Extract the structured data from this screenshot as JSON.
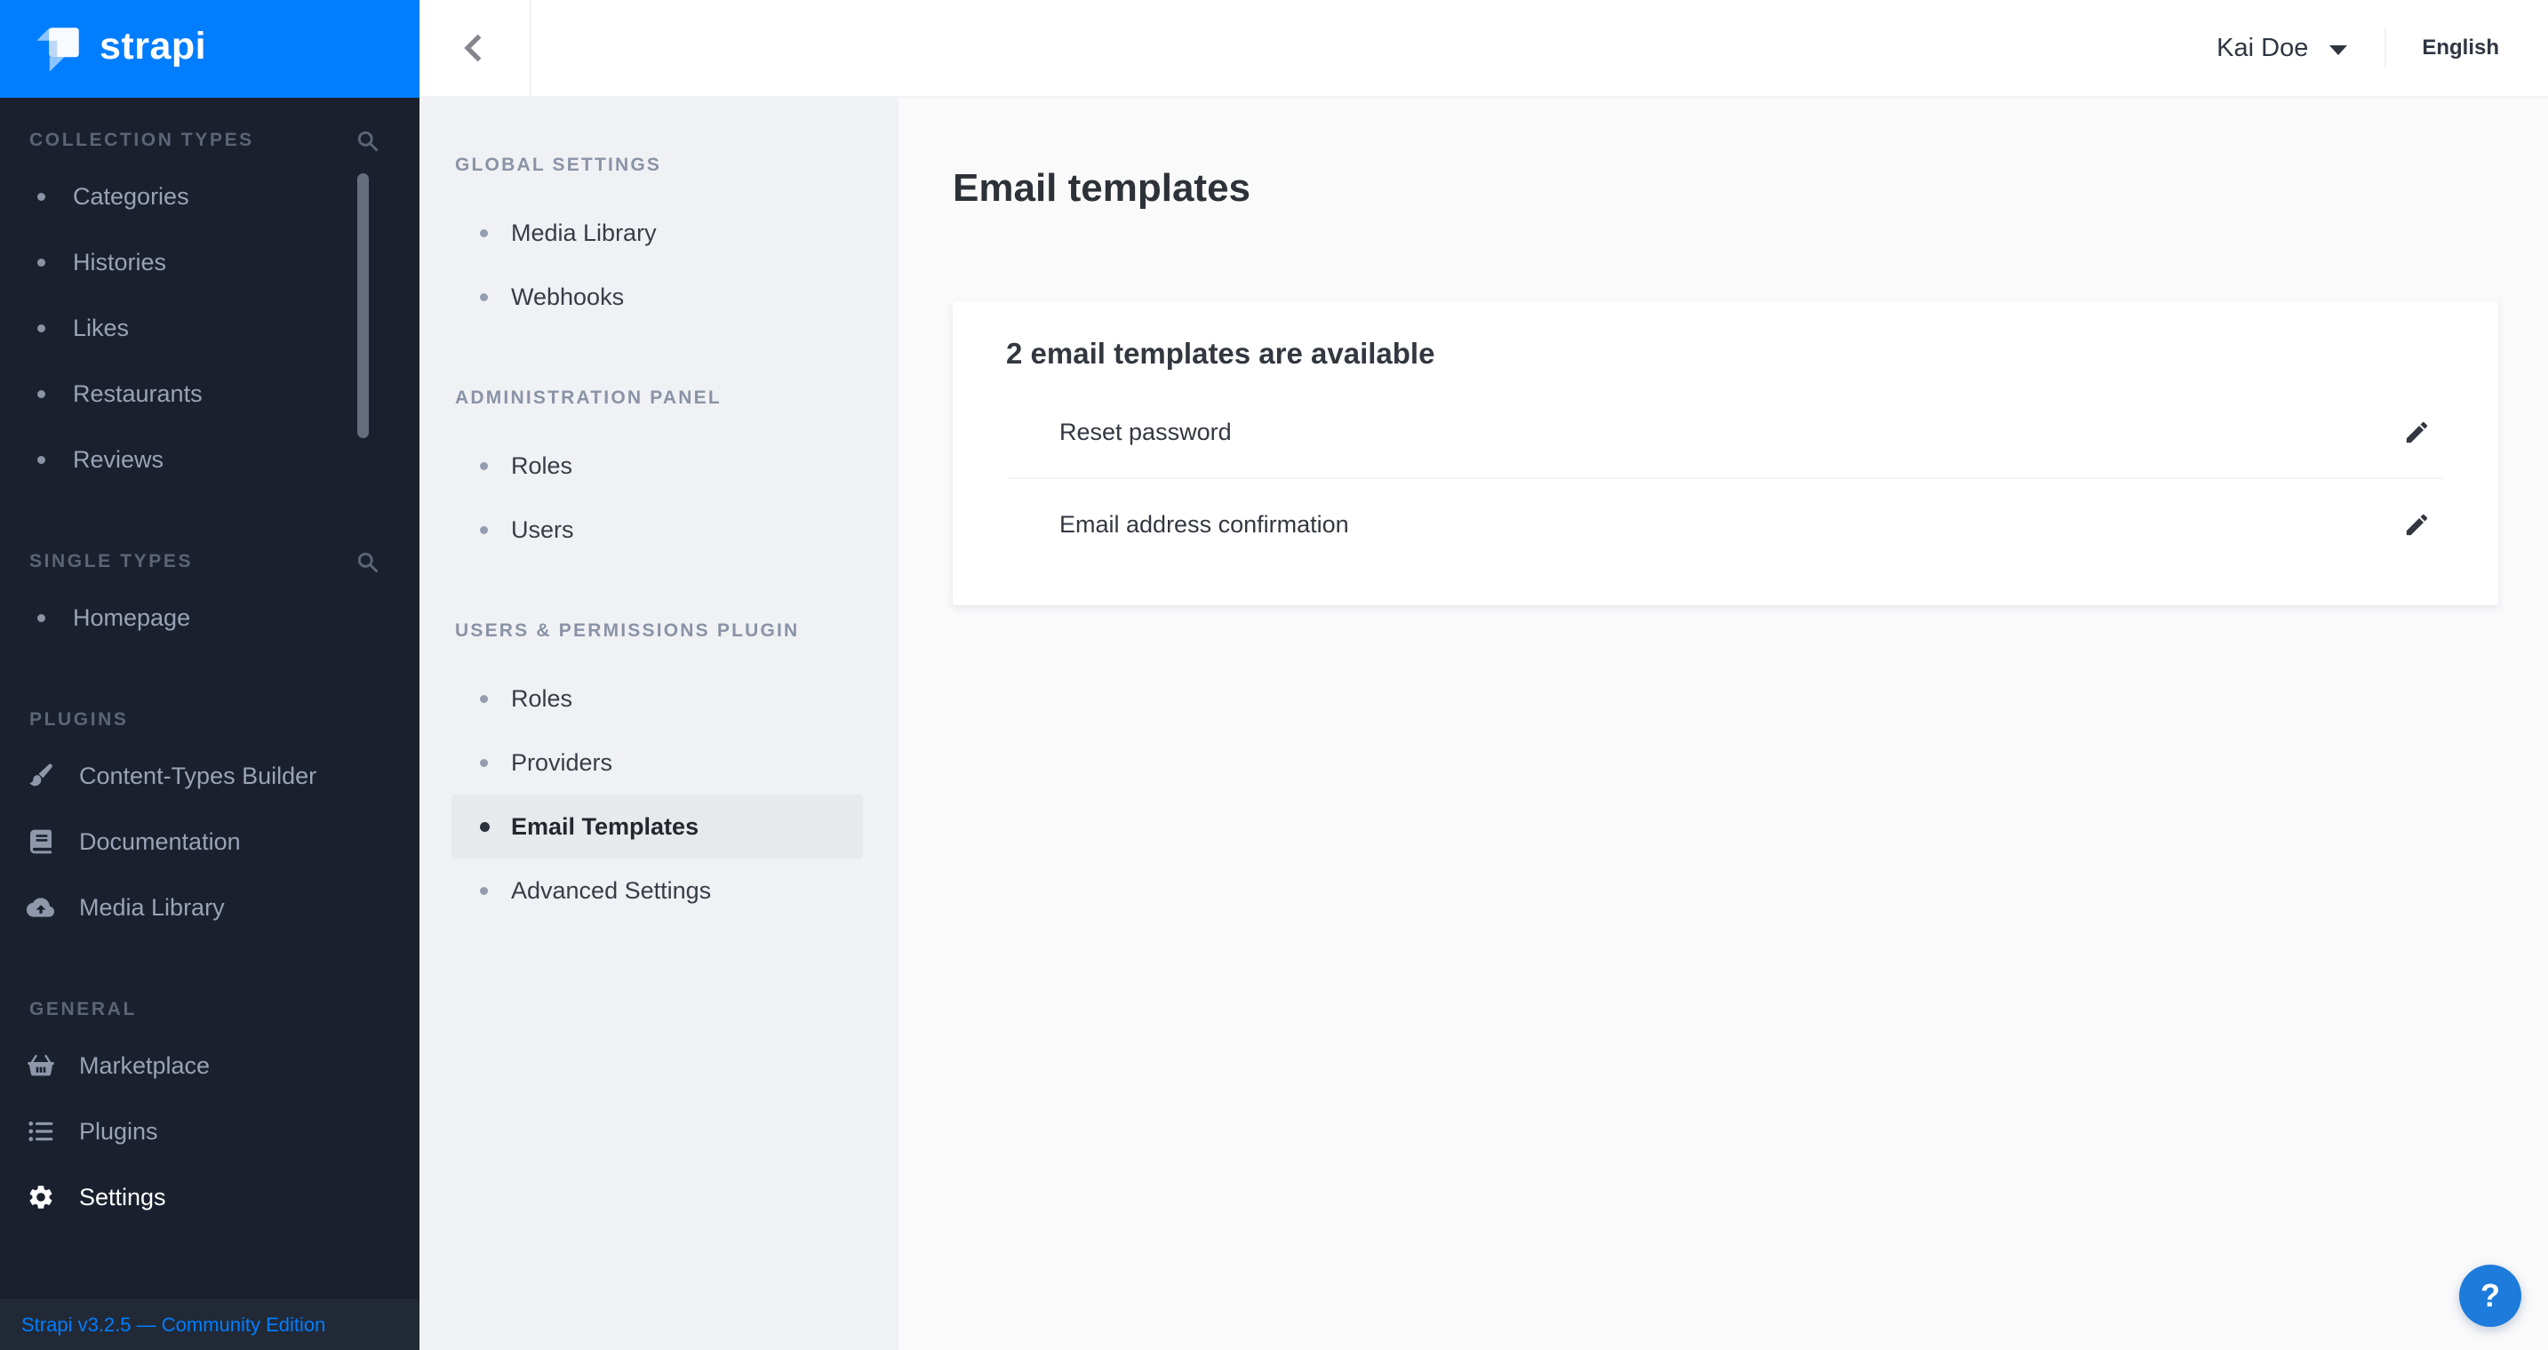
{
  "brand": {
    "wordmark": "strapi"
  },
  "colors": {
    "accent": "#007eff",
    "sidebar_bg": "#1a202e",
    "sidebar_footer_bg": "#212937",
    "settings_sidebar_bg": "#f0f1f4",
    "active_item_highlight": "#e8e9ec",
    "help_button": "#1c7bdb"
  },
  "left_sidebar": {
    "sections": [
      {
        "label": "COLLECTION TYPES",
        "items": [
          {
            "label": "Categories"
          },
          {
            "label": "Histories"
          },
          {
            "label": "Likes"
          },
          {
            "label": "Restaurants"
          },
          {
            "label": "Reviews"
          }
        ]
      },
      {
        "label": "SINGLE TYPES",
        "items": [
          {
            "label": "Homepage"
          }
        ]
      },
      {
        "label": "PLUGINS",
        "items": [
          {
            "label": "Content-Types Builder"
          },
          {
            "label": "Documentation"
          },
          {
            "label": "Media Library"
          }
        ]
      },
      {
        "label": "GENERAL",
        "items": [
          {
            "label": "Marketplace"
          },
          {
            "label": "Plugins"
          },
          {
            "label": "Settings"
          }
        ]
      }
    ],
    "footer_version": "Strapi v3.2.5 — Community Edition"
  },
  "topbar": {
    "user_name": "Kai Doe",
    "language": "English"
  },
  "settings_sidebar": {
    "sections": [
      {
        "label": "GLOBAL SETTINGS",
        "items": [
          {
            "label": "Media Library"
          },
          {
            "label": "Webhooks"
          }
        ]
      },
      {
        "label": "ADMINISTRATION PANEL",
        "items": [
          {
            "label": "Roles"
          },
          {
            "label": "Users"
          }
        ]
      },
      {
        "label": "USERS & PERMISSIONS PLUGIN",
        "items": [
          {
            "label": "Roles"
          },
          {
            "label": "Providers"
          },
          {
            "label": "Email Templates"
          },
          {
            "label": "Advanced Settings"
          }
        ]
      }
    ]
  },
  "main": {
    "title": "Email templates",
    "card": {
      "header": "2 email templates are available",
      "rows": [
        {
          "label": "Reset password"
        },
        {
          "label": "Email address confirmation"
        }
      ]
    }
  },
  "help_button": {
    "label": "?"
  }
}
